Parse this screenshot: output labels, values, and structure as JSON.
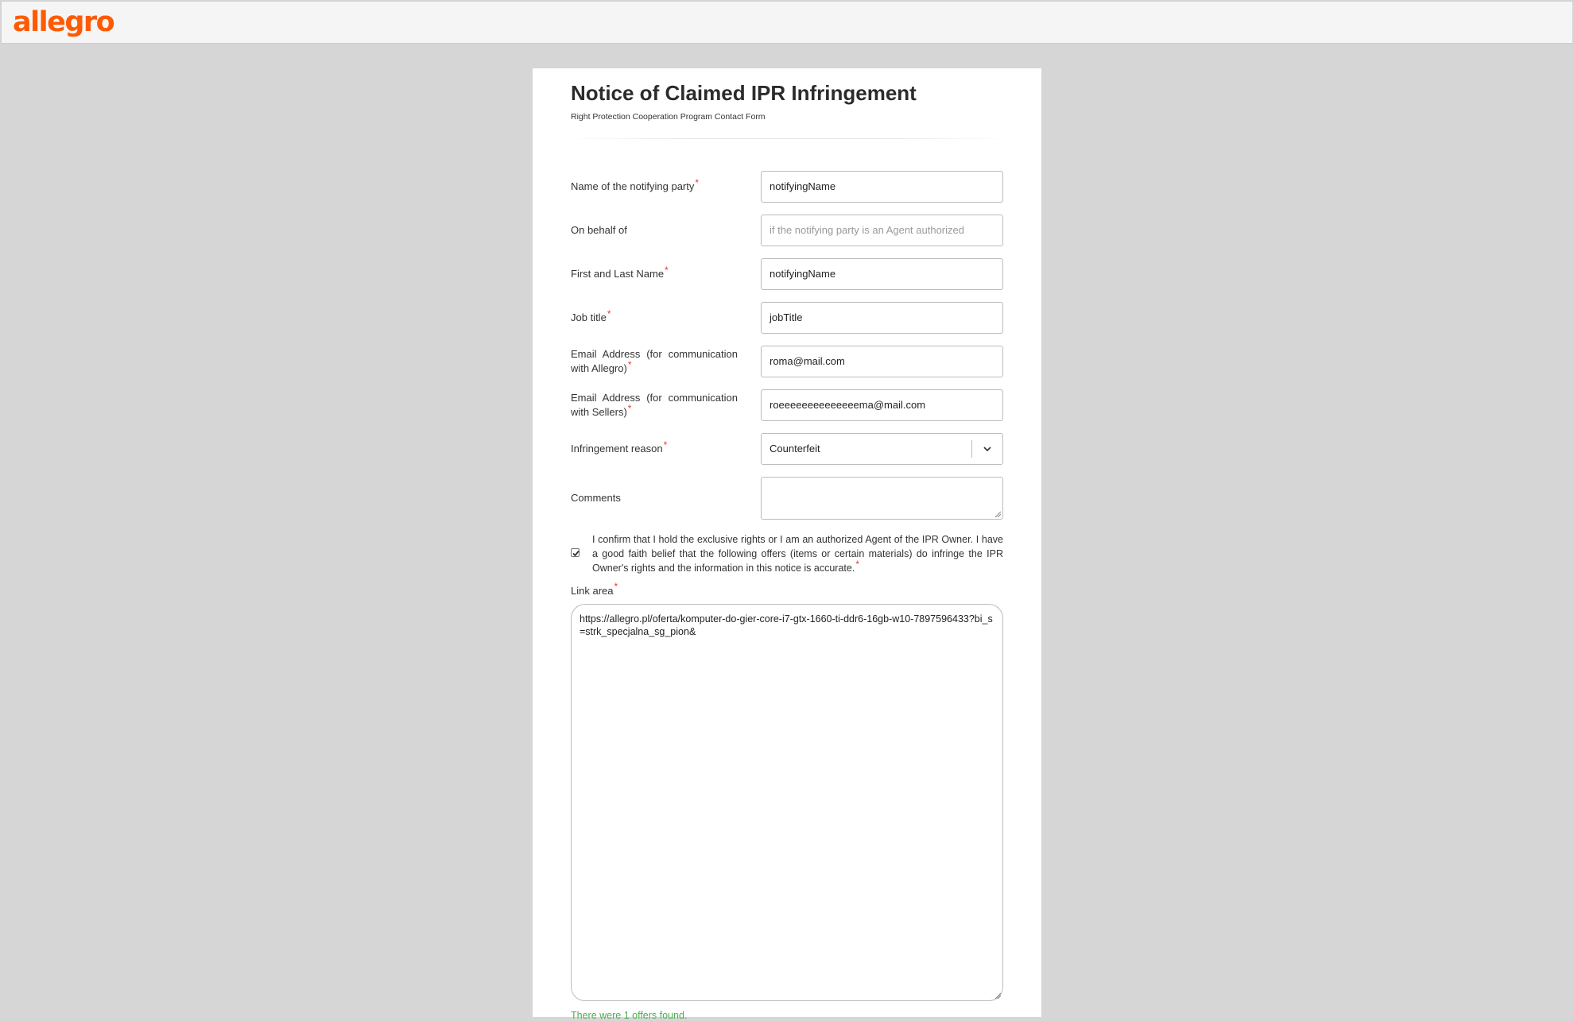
{
  "header": {
    "logo_text": "allegro",
    "brand_color": "#ff5a00"
  },
  "form": {
    "title": "Notice of Claimed IPR Infringement",
    "subtitle": "Right Protection Cooperation Program Contact Form",
    "required_marker": "*",
    "fields": {
      "notifying_party": {
        "label": "Name of the notifying party",
        "value": "notifyingName"
      },
      "on_behalf_of": {
        "label": "On behalf of",
        "placeholder": "if the notifying party is an Agent authorized"
      },
      "first_last_name": {
        "label": "First and Last Name",
        "value": "notifyingName"
      },
      "job_title": {
        "label": "Job title",
        "value": "jobTitle"
      },
      "email_allegro": {
        "label": "Email Address (for communication with Allegro)",
        "value": "roma@mail.com"
      },
      "email_sellers": {
        "label": "Email Address (for communication with Sellers)",
        "value": "roeeeeeeeeeeeeeema@mail.com"
      },
      "infringement_reason": {
        "label": "Infringement reason",
        "value": "Counterfeit"
      },
      "comments": {
        "label": "Comments",
        "value": ""
      }
    },
    "confirm": {
      "checked": true,
      "text": "I confirm that I hold the exclusive rights or I am an authorized Agent of the IPR Owner. I have a good faith belief that the following offers (items or certain materials) do infringe the IPR Owner's rights and the information in this notice is accurate."
    },
    "link_area": {
      "label": "Link area",
      "value": "https://allegro.pl/oferta/komputer-do-gier-core-i7-gtx-1660-ti-ddr6-16gb-w10-7897596433?bi_s=strk_specjalna_sg_pion&"
    },
    "offers_found": "There were 1 offers found."
  },
  "colors": {
    "required": "#e53935",
    "success": "#4caf50",
    "page_bg": "#d6d6d6"
  }
}
